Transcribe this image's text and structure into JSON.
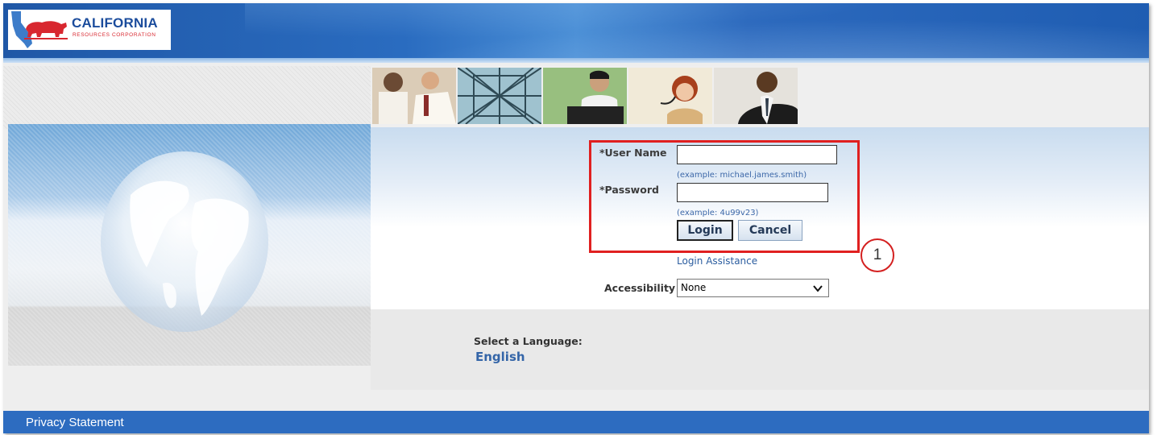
{
  "logo": {
    "name": "CALIFORNIA",
    "subtitle": "RESOURCES CORPORATION"
  },
  "login_form": {
    "username_label": "*User Name",
    "username_value": "",
    "username_hint": "(example: michael.james.smith)",
    "password_label": "*Password",
    "password_value": "",
    "password_hint": "(example: 4u99v23)",
    "login_button": "Login",
    "cancel_button": "Cancel",
    "assistance_link": "Login Assistance"
  },
  "accessibility": {
    "label": "Accessibility",
    "selected": "None"
  },
  "language": {
    "prompt": "Select a Language:",
    "option": "English"
  },
  "callout": {
    "number": "1"
  },
  "footer": {
    "privacy_link": "Privacy Statement"
  },
  "colors": {
    "header_blue": "#2a6cc0",
    "footer_blue": "#2d6cc0",
    "highlight_red": "#e02020",
    "link_blue": "#2b5d9f",
    "logo_red": "#d8272f",
    "logo_blue": "#1b4c9c"
  }
}
